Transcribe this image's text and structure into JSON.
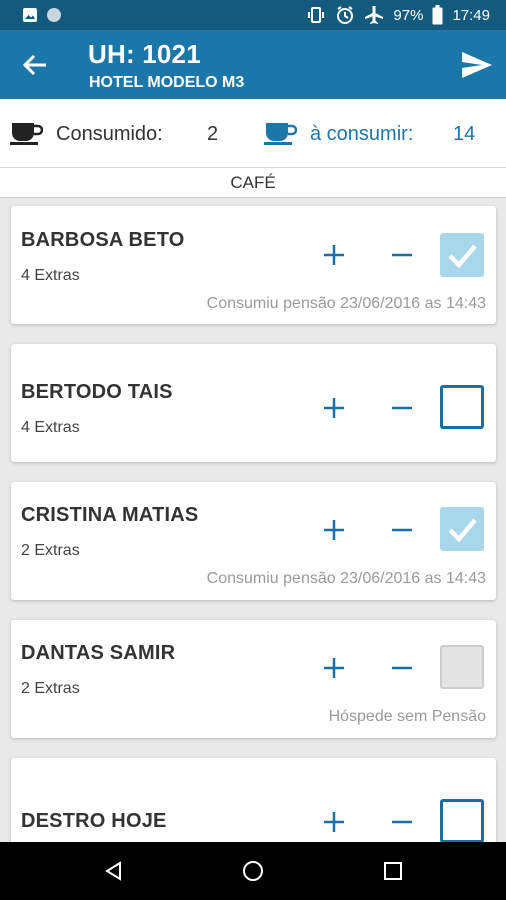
{
  "status_bar": {
    "battery_percent": "97%",
    "time": "17:49",
    "icons": [
      "image-icon",
      "circle-icon",
      "vibrate-icon",
      "alarm-icon",
      "airplane-icon",
      "battery-icon"
    ]
  },
  "header": {
    "title": "UH: 1021",
    "subtitle": "HOTEL MODELO M3",
    "icons": [
      "arrow-back-icon",
      "send-icon"
    ]
  },
  "summary": {
    "consumed_label": "Consumido:",
    "consumed_count": "2",
    "to_consume_label": "à consumir:",
    "to_consume_count": "14",
    "icons": [
      "coffee-cup-icon"
    ],
    "colors": {
      "accent": "#1b77a8",
      "dark": "#135a7c"
    }
  },
  "section": {
    "title": "CAFÉ"
  },
  "guests": [
    {
      "name": "BARBOSA BETO",
      "extras": "4 Extras",
      "note": "Consumiu pensão 23/06/2016 as 14:43",
      "check_state": "checked"
    },
    {
      "name": "BERTODO TAIS",
      "extras": "4 Extras",
      "note": "",
      "check_state": "unchecked"
    },
    {
      "name": "CRISTINA MATIAS",
      "extras": "2 Extras",
      "note": "Consumiu pensão 23/06/2016 as 14:43",
      "check_state": "checked"
    },
    {
      "name": "DANTAS SAMIR",
      "extras": "2 Extras",
      "note": "Hóspede sem Pensão",
      "check_state": "disabled"
    },
    {
      "name": "DESTRO HOJE",
      "extras": "",
      "note": "",
      "check_state": "unchecked"
    }
  ],
  "nav_bar": {
    "icons": [
      "back-triangle-icon",
      "home-circle-icon",
      "recents-square-icon"
    ]
  }
}
